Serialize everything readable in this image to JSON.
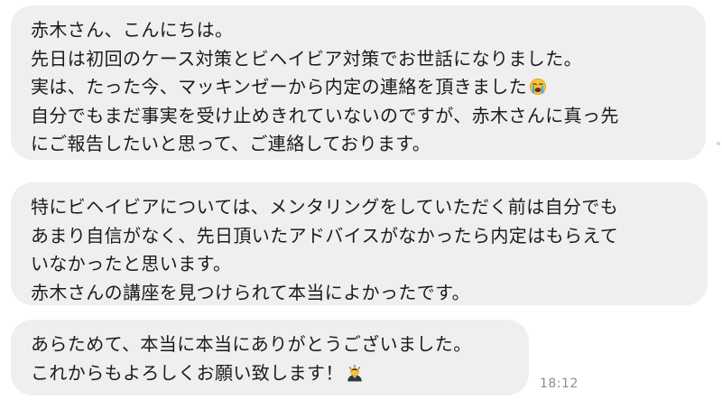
{
  "chat": {
    "messages": [
      {
        "lines": [
          "赤木さん、こんにちは。",
          "先日は初回のケース対策とビヘイビア対策でお世話になりました。",
          "実は、たった今、マッキンゼーから内定の連絡を頂きました",
          "自分でもまだ事実を受け止めきれていないのですが、赤木さんに真っ先",
          "にご報告したいと思って、ご連絡しております。"
        ],
        "emoji": "loudly-crying-face"
      },
      {
        "lines": [
          "特にビヘイビアについては、メンタリングをしていただく前は自分でも",
          "あまり自信がなく、先日頂いたアドバイスがなかったら内定はもらえて",
          "いなかったと思います。",
          "赤木さんの講座を見つけられて本当によかったです。"
        ]
      },
      {
        "lines": [
          "あらためて、本当に本当にありがとうございました。",
          "これからもよろしくお願い致します！"
        ],
        "emoji": "person-bowing",
        "timestamp": "18:12"
      }
    ]
  },
  "colors": {
    "bubble_background": "#efefef",
    "text": "#1c1c1c",
    "timestamp": "#8e8e8e",
    "page_background": "#ffffff"
  }
}
